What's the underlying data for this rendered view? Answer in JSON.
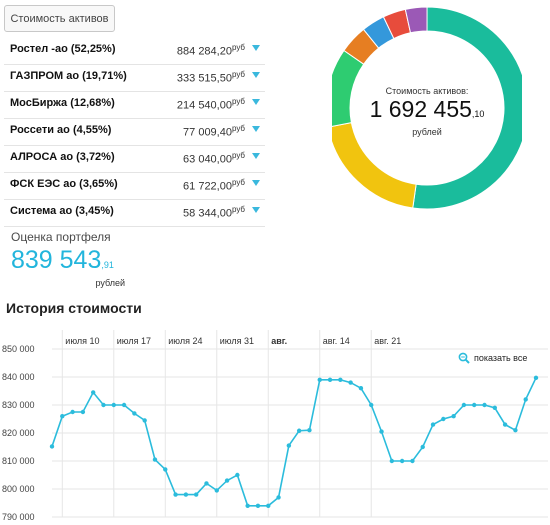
{
  "tab_label": "Стоимость активов",
  "assets": [
    {
      "name": "Ростел -ао (52,25%)",
      "value": "884 284,20",
      "unit": "руб"
    },
    {
      "name": "ГАЗПРОМ ао (19,71%)",
      "value": "333 515,50",
      "unit": "руб"
    },
    {
      "name": "МосБиржа (12,68%)",
      "value": "214 540,00",
      "unit": "руб"
    },
    {
      "name": "Россети ао (4,55%)",
      "value": "77 009,40",
      "unit": "руб"
    },
    {
      "name": "АЛРОСА ао (3,72%)",
      "value": "63 040,00",
      "unit": "руб"
    },
    {
      "name": "ФСК ЕЭС ао (3,65%)",
      "value": "61 722,00",
      "unit": "руб"
    },
    {
      "name": "Система ао (3,45%)",
      "value": "58 344,00",
      "unit": "руб"
    }
  ],
  "portfolio": {
    "label": "Оценка портфеля",
    "value": "839 543",
    "cents": ",91",
    "unit": "рублей"
  },
  "donut": {
    "label": "Стоимость активов:",
    "value": "1 692 455",
    "cents": ",10",
    "unit": "рублей",
    "segments": [
      {
        "share": 52.25,
        "color": "#1abc9c"
      },
      {
        "share": 19.71,
        "color": "#f1c40f"
      },
      {
        "share": 12.68,
        "color": "#2ecc71"
      },
      {
        "share": 4.55,
        "color": "#e67e22"
      },
      {
        "share": 3.72,
        "color": "#3498db"
      },
      {
        "share": 3.65,
        "color": "#e74c3c"
      },
      {
        "share": 3.45,
        "color": "#9b59b6"
      }
    ]
  },
  "history": {
    "title": "История стоимости",
    "show_all": "показать все"
  },
  "chart_data": {
    "type": "line",
    "ylim": [
      790000,
      850000
    ],
    "yticks": [
      790000,
      800000,
      810000,
      820000,
      830000,
      840000,
      850000
    ],
    "ytick_labels": [
      "790 000",
      "800 000",
      "810 000",
      "820 000",
      "830 000",
      "840 000",
      "850 000"
    ],
    "xticks": [
      {
        "label": "июля 10",
        "index": 1,
        "bold": false
      },
      {
        "label": "июля 17",
        "index": 6,
        "bold": false
      },
      {
        "label": "июля 24",
        "index": 11,
        "bold": false
      },
      {
        "label": "июля 31",
        "index": 16,
        "bold": false
      },
      {
        "label": "авг.",
        "index": 21,
        "bold": true
      },
      {
        "label": "авг. 14",
        "index": 26,
        "bold": false
      },
      {
        "label": "авг. 21",
        "index": 31,
        "bold": false
      }
    ],
    "line_color": "#2bbcdc",
    "grid": true,
    "values": [
      815200,
      826000,
      827500,
      827500,
      834500,
      830000,
      830000,
      830000,
      827000,
      824500,
      810500,
      807000,
      798000,
      798000,
      798000,
      802000,
      799500,
      803000,
      805000,
      794000,
      794000,
      794000,
      797000,
      815500,
      820800,
      821000,
      839000,
      839000,
      839000,
      838000,
      836000,
      830000,
      820500,
      810000,
      810000,
      810000,
      815000,
      823000,
      825000,
      826000,
      830000,
      830000,
      830000,
      829000,
      823000,
      821000,
      832000,
      839700
    ]
  }
}
